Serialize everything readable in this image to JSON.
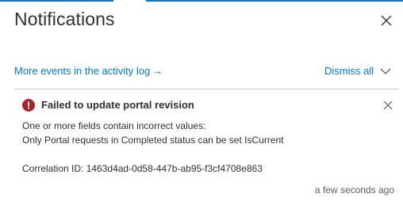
{
  "panel": {
    "title": "Notifications",
    "activity_link": "More events in the activity log",
    "activity_arrow": "→",
    "dismiss_all": "Dismiss all"
  },
  "notification": {
    "title": "Failed to update portal revision",
    "message_line1": "One or more fields contain incorrect values:",
    "message_line2": "Only Portal requests in Completed status can be set IsCurrent",
    "correlation": "Correlation ID: 1463d4ad-0d58-447b-ab95-f3cf4708e863",
    "timestamp": "a few seconds ago",
    "status_icon": "error-circle-icon"
  },
  "colors": {
    "accent": "#0078d4",
    "error": "#a4262c",
    "text": "#323130",
    "muted": "#605e5c",
    "divider": "#c8c6c4"
  }
}
